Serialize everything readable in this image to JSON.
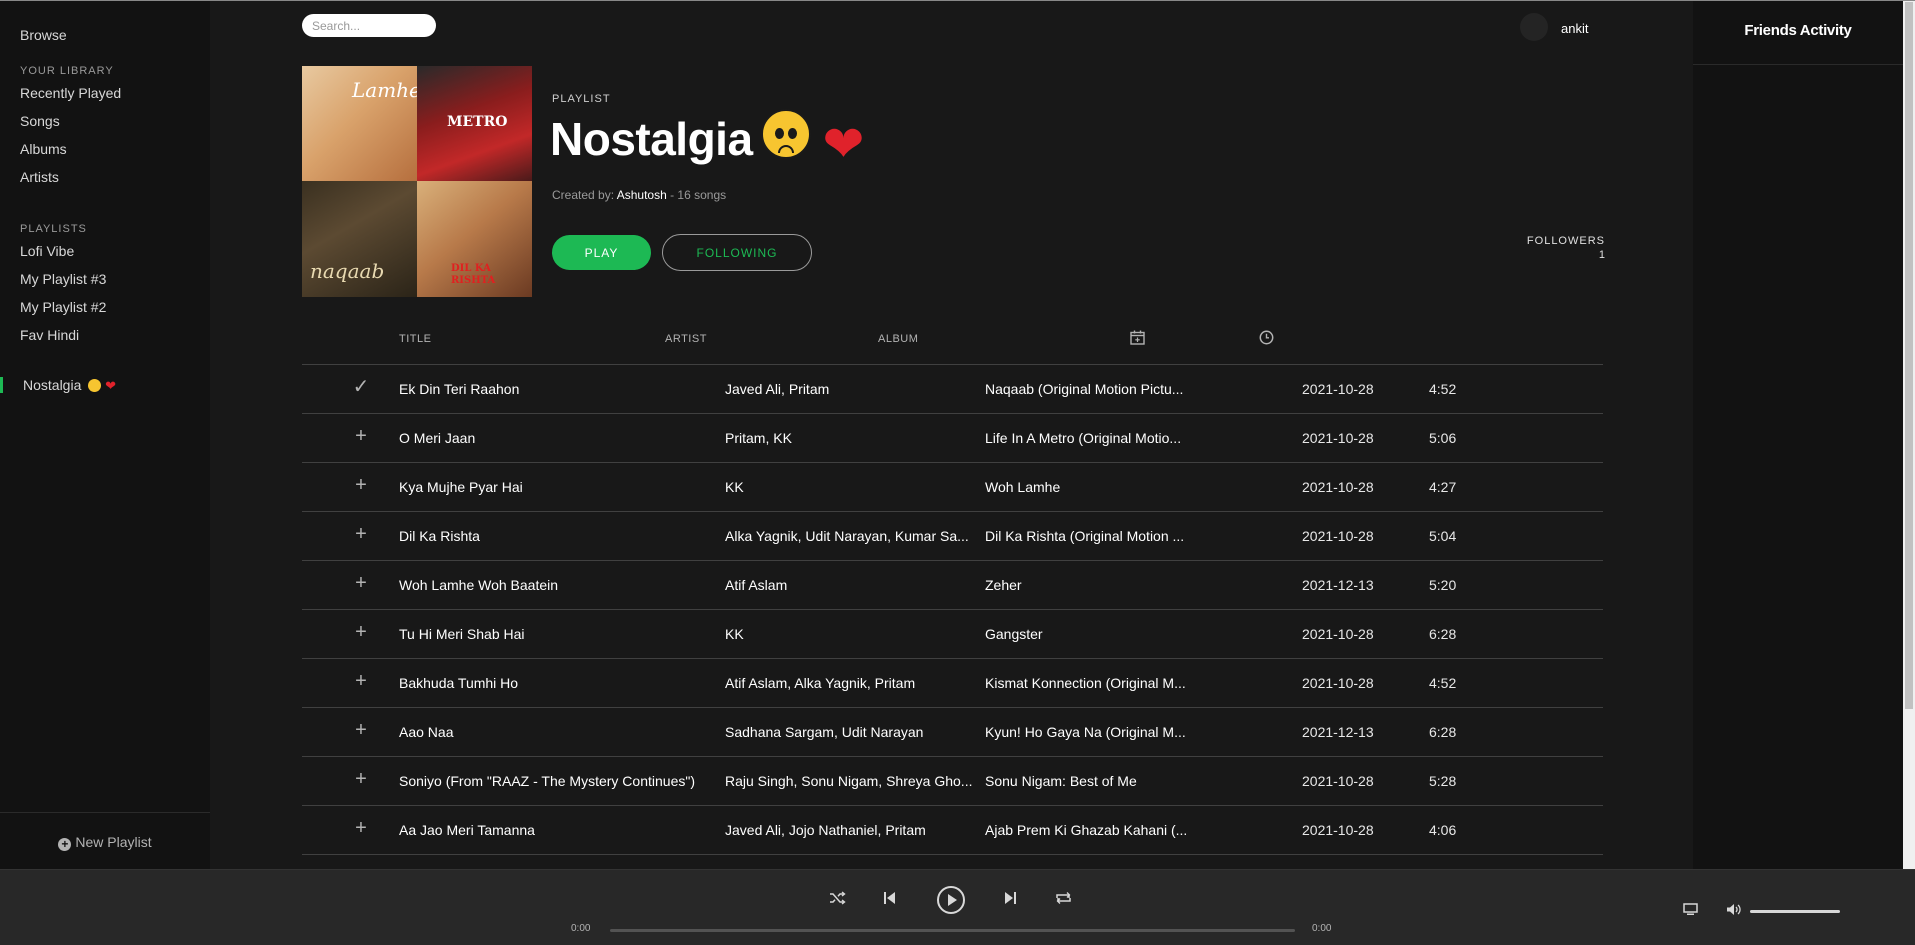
{
  "sidebar": {
    "browse": "Browse",
    "library_heading": "YOUR LIBRARY",
    "library_items": [
      "Recently Played",
      "Songs",
      "Albums",
      "Artists"
    ],
    "playlists_heading": "PLAYLISTS",
    "playlists": [
      "Lofi Vibe",
      "My Playlist #3",
      "My Playlist #2",
      "Fav Hindi",
      "Nostalgia"
    ],
    "new_playlist": "New Playlist"
  },
  "header": {
    "search_placeholder": "Search...",
    "username": "ankit"
  },
  "playlist": {
    "type_label": "PLAYLIST",
    "title": "Nostalgia",
    "created_by_prefix": "Created by:",
    "creator": "Ashutosh",
    "song_count": " - 16 songs",
    "play_label": "PLAY",
    "following_label": "FOLLOWING",
    "followers_label": "FOLLOWERS",
    "followers_count": "1",
    "cover_texts": [
      "Lamhe",
      "METRO",
      "naqaab",
      "DIL KA RISHTA"
    ]
  },
  "table": {
    "headers": {
      "title": "TITLE",
      "artist": "ARTIST",
      "album": "ALBUM"
    },
    "rows": [
      {
        "title": "Ek Din Teri Raahon",
        "artist": "Javed Ali, Pritam",
        "album": "Naqaab (Original Motion Pictu...",
        "date": "2021-10-28",
        "duration": "4:52",
        "added": true
      },
      {
        "title": "O Meri Jaan",
        "artist": "Pritam, KK",
        "album": "Life In A Metro (Original Motio...",
        "date": "2021-10-28",
        "duration": "5:06",
        "added": false
      },
      {
        "title": "Kya Mujhe Pyar Hai",
        "artist": "KK",
        "album": "Woh Lamhe",
        "date": "2021-10-28",
        "duration": "4:27",
        "added": false
      },
      {
        "title": "Dil Ka Rishta",
        "artist": "Alka Yagnik, Udit Narayan, Kumar Sa...",
        "album": "Dil Ka Rishta (Original Motion ...",
        "date": "2021-10-28",
        "duration": "5:04",
        "added": false
      },
      {
        "title": "Woh Lamhe Woh Baatein",
        "artist": "Atif Aslam",
        "album": "Zeher",
        "date": "2021-12-13",
        "duration": "5:20",
        "added": false
      },
      {
        "title": "Tu Hi Meri Shab Hai",
        "artist": "KK",
        "album": "Gangster",
        "date": "2021-10-28",
        "duration": "6:28",
        "added": false
      },
      {
        "title": "Bakhuda Tumhi Ho",
        "artist": "Atif Aslam, Alka Yagnik, Pritam",
        "album": "Kismat Konnection (Original M...",
        "date": "2021-10-28",
        "duration": "4:52",
        "added": false
      },
      {
        "title": "Aao Naa",
        "artist": "Sadhana Sargam, Udit Narayan",
        "album": "Kyun! Ho Gaya Na (Original M...",
        "date": "2021-12-13",
        "duration": "6:28",
        "added": false
      },
      {
        "title": "Soniyo (From \"RAAZ - The Mystery Continues\")",
        "artist": "Raju Singh, Sonu Nigam, Shreya Gho...",
        "album": "Sonu Nigam: Best of Me",
        "date": "2021-10-28",
        "duration": "5:28",
        "added": false
      },
      {
        "title": "Aa Jao Meri Tamanna",
        "artist": "Javed Ali, Jojo Nathaniel, Pritam",
        "album": "Ajab Prem Ki Ghazab Kahani (...",
        "date": "2021-10-28",
        "duration": "4:06",
        "added": false
      }
    ]
  },
  "friends": {
    "title": "Friends Activity"
  },
  "player": {
    "current_time": "0:00",
    "total_time": "0:00",
    "progress": 0,
    "volume": 1.0
  },
  "colors": {
    "accent": "#1db954",
    "background": "#181818",
    "sidebar": "#121212",
    "player": "#282828"
  }
}
